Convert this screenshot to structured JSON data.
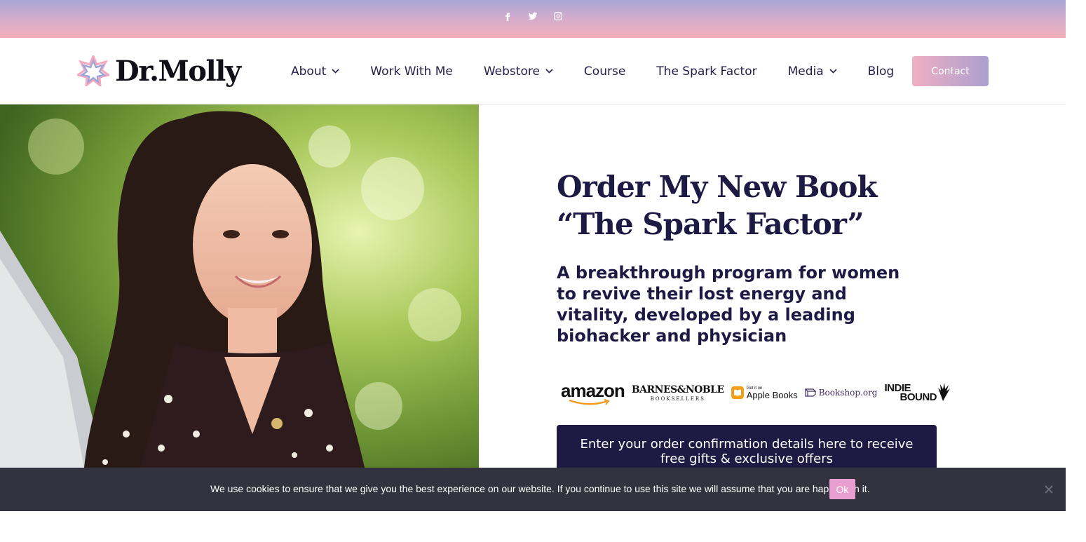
{
  "topbar": {
    "social": [
      {
        "icon": "facebook-icon"
      },
      {
        "icon": "twitter-icon"
      },
      {
        "icon": "instagram-icon"
      }
    ]
  },
  "header": {
    "logo_text": "Dr.Molly",
    "nav": [
      {
        "label": "About",
        "has_dropdown": true
      },
      {
        "label": "Work With Me",
        "has_dropdown": false
      },
      {
        "label": "Webstore",
        "has_dropdown": true
      },
      {
        "label": "Course",
        "has_dropdown": false
      },
      {
        "label": "The Spark Factor",
        "has_dropdown": false
      },
      {
        "label": "Media",
        "has_dropdown": true
      },
      {
        "label": "Blog",
        "has_dropdown": false
      }
    ],
    "contact_label": "Contact"
  },
  "hero": {
    "title": "Order My New Book “The Spark Factor”",
    "subtitle": "A breakthrough program for women to revive their lost energy and vitality, developed by a leading biohacker and physician",
    "retailers": {
      "amazon": "amazon",
      "bn_top": "BARNES&NOBLE",
      "bn_bottom": "BOOKSELLERS",
      "apple_small": "Get it on",
      "apple_name": "Apple Books",
      "bookshop": "Bookshop.org",
      "indie_line1": "INDIE",
      "indie_line2": "BOUND"
    },
    "cta_text": "Enter your order confirmation details here to receive free gifts & exclusive offers"
  },
  "cookie": {
    "text": "We use cookies to ensure that we give you the best experience on our website. If you continue to use this site we will assume that you are happy with it.",
    "ok_label": "Ok"
  },
  "colors": {
    "navy": "#1d1a44",
    "contact_gradient_start": "#f0afc2",
    "contact_gradient_end": "#ab9fd0",
    "cookie_bg": "#32333e",
    "cookie_ok": "#e99ed2"
  }
}
